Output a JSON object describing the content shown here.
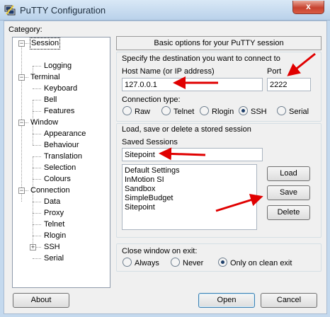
{
  "window": {
    "title": "PuTTY Configuration",
    "close_glyph": "x"
  },
  "category_label": "Category:",
  "tree": [
    {
      "label": "Session",
      "selected": true
    },
    {
      "label": "Logging"
    },
    {
      "label": "Terminal"
    },
    {
      "label": "Keyboard"
    },
    {
      "label": "Bell"
    },
    {
      "label": "Features"
    },
    {
      "label": "Window"
    },
    {
      "label": "Appearance"
    },
    {
      "label": "Behaviour"
    },
    {
      "label": "Translation"
    },
    {
      "label": "Selection"
    },
    {
      "label": "Colours"
    },
    {
      "label": "Connection"
    },
    {
      "label": "Data"
    },
    {
      "label": "Proxy"
    },
    {
      "label": "Telnet"
    },
    {
      "label": "Rlogin"
    },
    {
      "label": "SSH"
    },
    {
      "label": "Serial"
    }
  ],
  "panel": {
    "header": "Basic options for your PuTTY session",
    "destination": {
      "title": "Specify the destination you want to connect to",
      "host_label": "Host Name (or IP address)",
      "host_value": "127.0.0.1",
      "port_label": "Port",
      "port_value": "2222",
      "conn_type_label": "Connection type:",
      "types": [
        "Raw",
        "Telnet",
        "Rlogin",
        "SSH",
        "Serial"
      ],
      "selected_type": "SSH"
    },
    "sessions": {
      "title": "Load, save or delete a stored session",
      "saved_label": "Saved Sessions",
      "saved_value": "Sitepoint",
      "list": [
        "Default Settings",
        "InMotion SI",
        "Sandbox",
        "SimpleBudget",
        "Sitepoint"
      ],
      "load": "Load",
      "save": "Save",
      "delete": "Delete"
    },
    "close_on_exit": {
      "label": "Close window on exit:",
      "options": [
        "Always",
        "Never",
        "Only on clean exit"
      ],
      "selected": "Only on clean exit"
    }
  },
  "buttons": {
    "about": "About",
    "open": "Open",
    "cancel": "Cancel"
  },
  "colors": {
    "arrow": "#e00000",
    "titlebar": "#c4d9ee"
  }
}
